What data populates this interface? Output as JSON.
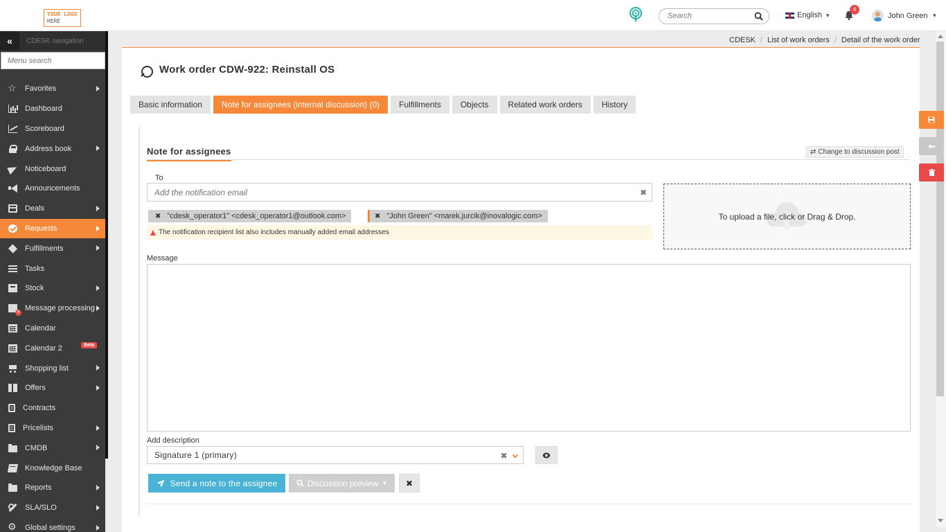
{
  "topbar": {
    "logo_line1": "YOUR LOGO",
    "logo_line2": "HERE",
    "search_placeholder": "Search",
    "language": "English",
    "notifications_count": "4",
    "user_name": "John Green"
  },
  "sidebar": {
    "title": "CDESK navigation",
    "menu_search_placeholder": "Menu search",
    "items": [
      {
        "label": "Favorites",
        "icon": "star-icon",
        "submenu": true
      },
      {
        "label": "Dashboard",
        "icon": "bar-chart-icon",
        "submenu": false
      },
      {
        "label": "Scoreboard",
        "icon": "line-chart-icon",
        "submenu": false
      },
      {
        "label": "Address book",
        "icon": "lock-icon",
        "submenu": true
      },
      {
        "label": "Noticeboard",
        "icon": "paper-plane-icon",
        "submenu": false
      },
      {
        "label": "Announcements",
        "icon": "bullhorn-icon",
        "submenu": false
      },
      {
        "label": "Deals",
        "icon": "credit-card-icon",
        "submenu": true
      },
      {
        "label": "Requests",
        "icon": "check-circle-icon",
        "submenu": true,
        "active": true
      },
      {
        "label": "Fulfillments",
        "icon": "cube-icon",
        "submenu": true
      },
      {
        "label": "Tasks",
        "icon": "tasks-icon",
        "submenu": false
      },
      {
        "label": "Stock",
        "icon": "archive-icon",
        "submenu": true
      },
      {
        "label": "Message processing",
        "icon": "envelope-icon",
        "submenu": true,
        "badge": "9"
      },
      {
        "label": "Calendar",
        "icon": "calendar-icon",
        "submenu": false
      },
      {
        "label": "Calendar 2",
        "icon": "calendar-icon",
        "submenu": false,
        "beta": "Beta"
      },
      {
        "label": "Shopping list",
        "icon": "cart-icon",
        "submenu": true
      },
      {
        "label": "Offers",
        "icon": "gift-icon",
        "submenu": true
      },
      {
        "label": "Contracts",
        "icon": "document-icon",
        "submenu": false
      },
      {
        "label": "Pricelists",
        "icon": "document-icon",
        "submenu": true
      },
      {
        "label": "CMDB",
        "icon": "folder-icon",
        "submenu": true
      },
      {
        "label": "Knowledge Base",
        "icon": "book-icon",
        "submenu": false
      },
      {
        "label": "Reports",
        "icon": "folder-open-icon",
        "submenu": true
      },
      {
        "label": "SLA/SLO",
        "icon": "wrench-icon",
        "submenu": true
      },
      {
        "label": "Global settings",
        "icon": "gears-icon",
        "submenu": true
      }
    ]
  },
  "breadcrumb": [
    "CDESK",
    "List of work orders",
    "Detail of the work order"
  ],
  "page": {
    "title": "Work order CDW-922: Reinstall OS",
    "tabs": [
      {
        "label": "Basic information",
        "active": false
      },
      {
        "label": "Note for assignees (internal discussion) (0)",
        "active": true
      },
      {
        "label": "Fulfillments",
        "active": false
      },
      {
        "label": "Objects",
        "active": false
      },
      {
        "label": "Related work orders",
        "active": false
      },
      {
        "label": "History",
        "active": false
      }
    ]
  },
  "note": {
    "section_title": "Note for assignees",
    "switch_label": "Change to discussion post",
    "to_label": "To",
    "to_placeholder": "Add the notification email",
    "recipients": [
      "\"cdesk_operator1\" <cdesk_operator1@outlook.com>",
      "\"John Green\" <marek.jurcik@inovalogic.com>"
    ],
    "warning": "The notification recipient list also includes manually added email addresses",
    "upload_text": "To upload a file, click or Drag & Drop.",
    "message_label": "Message",
    "message_value": "",
    "description_label": "Add description",
    "description_value": "Signature 1 (primary)",
    "send_label": "Send a note to the assignee",
    "preview_label": "Discussion preview"
  },
  "colors": {
    "accent": "#f6883a",
    "primary_button": "#4ab2d4",
    "danger": "#e84a4a",
    "sidebar_bg": "#3b3b3b"
  }
}
